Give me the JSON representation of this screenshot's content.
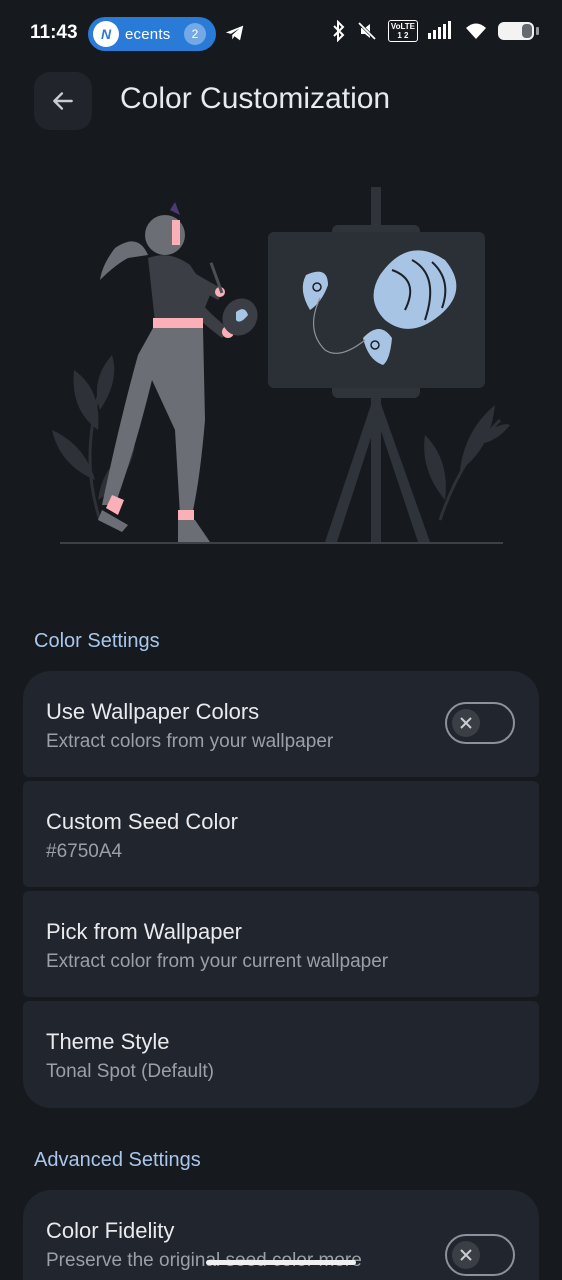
{
  "status_bar": {
    "time": "11:43",
    "notification_pill": {
      "text": "ecents",
      "badge": "2",
      "logo_letter": "N"
    },
    "volte_top": "VoLTE",
    "volte_bottom": "1 2"
  },
  "app_bar": {
    "title": "Color Customization"
  },
  "sections": [
    {
      "header": "Color Settings",
      "items": [
        {
          "title": "Use Wallpaper Colors",
          "subtitle": "Extract colors from your wallpaper",
          "toggle": "off"
        },
        {
          "title": "Custom Seed Color",
          "subtitle": "#6750A4"
        },
        {
          "title": "Pick from Wallpaper",
          "subtitle": "Extract color from your current wallpaper"
        },
        {
          "title": "Theme Style",
          "subtitle": "Tonal Spot (Default)"
        }
      ]
    },
    {
      "header": "Advanced Settings",
      "items": [
        {
          "title": "Color Fidelity",
          "subtitle": "Preserve the original seed color more",
          "toggle": "off"
        }
      ]
    }
  ],
  "colors": {
    "background": "#16191d",
    "card": "#21252d",
    "section_header": "#a9c6ec",
    "pill": "#2a7bd8",
    "accent_light_blue": "#a8c4e5"
  }
}
